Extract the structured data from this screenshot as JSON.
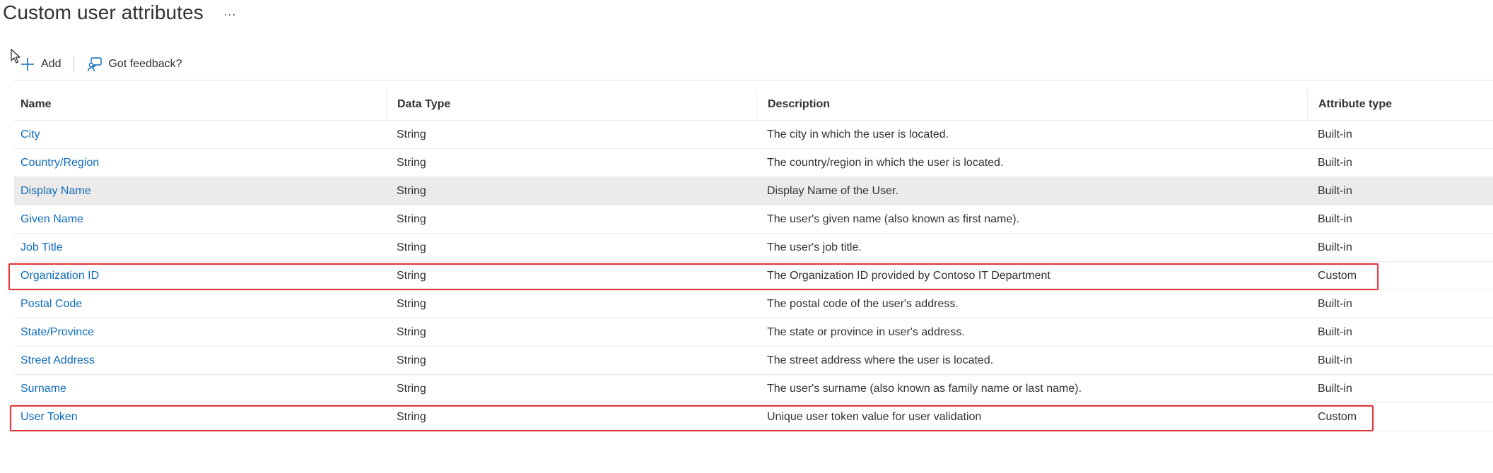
{
  "page": {
    "title": "Custom user attributes",
    "more_label": "···"
  },
  "toolbar": {
    "add_label": "Add",
    "feedback_label": "Got feedback?"
  },
  "table": {
    "columns": [
      "Name",
      "Data Type",
      "Description",
      "Attribute type"
    ],
    "rows": [
      {
        "name": "City",
        "type": "String",
        "description": "The city in which the user is located.",
        "attr": "Built-in"
      },
      {
        "name": "Country/Region",
        "type": "String",
        "description": "The country/region in which the user is located.",
        "attr": "Built-in"
      },
      {
        "name": "Display Name",
        "type": "String",
        "description": "Display Name of the User.",
        "attr": "Built-in"
      },
      {
        "name": "Given Name",
        "type": "String",
        "description": "The user's given name (also known as first name).",
        "attr": "Built-in"
      },
      {
        "name": "Job Title",
        "type": "String",
        "description": "The user's job title.",
        "attr": "Built-in"
      },
      {
        "name": "Organization ID",
        "type": "String",
        "description": "The Organization ID provided by Contoso IT Department",
        "attr": "Custom"
      },
      {
        "name": "Postal Code",
        "type": "String",
        "description": "The postal code of the user's address.",
        "attr": "Built-in"
      },
      {
        "name": "State/Province",
        "type": "String",
        "description": "The state or province in user's address.",
        "attr": "Built-in"
      },
      {
        "name": "Street Address",
        "type": "String",
        "description": "The street address where the user is located.",
        "attr": "Built-in"
      },
      {
        "name": "Surname",
        "type": "String",
        "description": "The user's surname (also known as family name or last name).",
        "attr": "Built-in"
      },
      {
        "name": "User Token",
        "type": "String",
        "description": "Unique user token value for user validation",
        "attr": "Custom"
      }
    ],
    "selected_row": "Display Name",
    "highlighted_rows": [
      "Organization ID",
      "User Token"
    ]
  },
  "colors": {
    "link": "#0f6cbd",
    "highlight_border": "#e0363a",
    "selected_row_bg": "#edebe9"
  },
  "icons": {
    "add": "plus-icon",
    "feedback": "feedback-person-icon",
    "cursor": "mouse-pointer-icon"
  }
}
